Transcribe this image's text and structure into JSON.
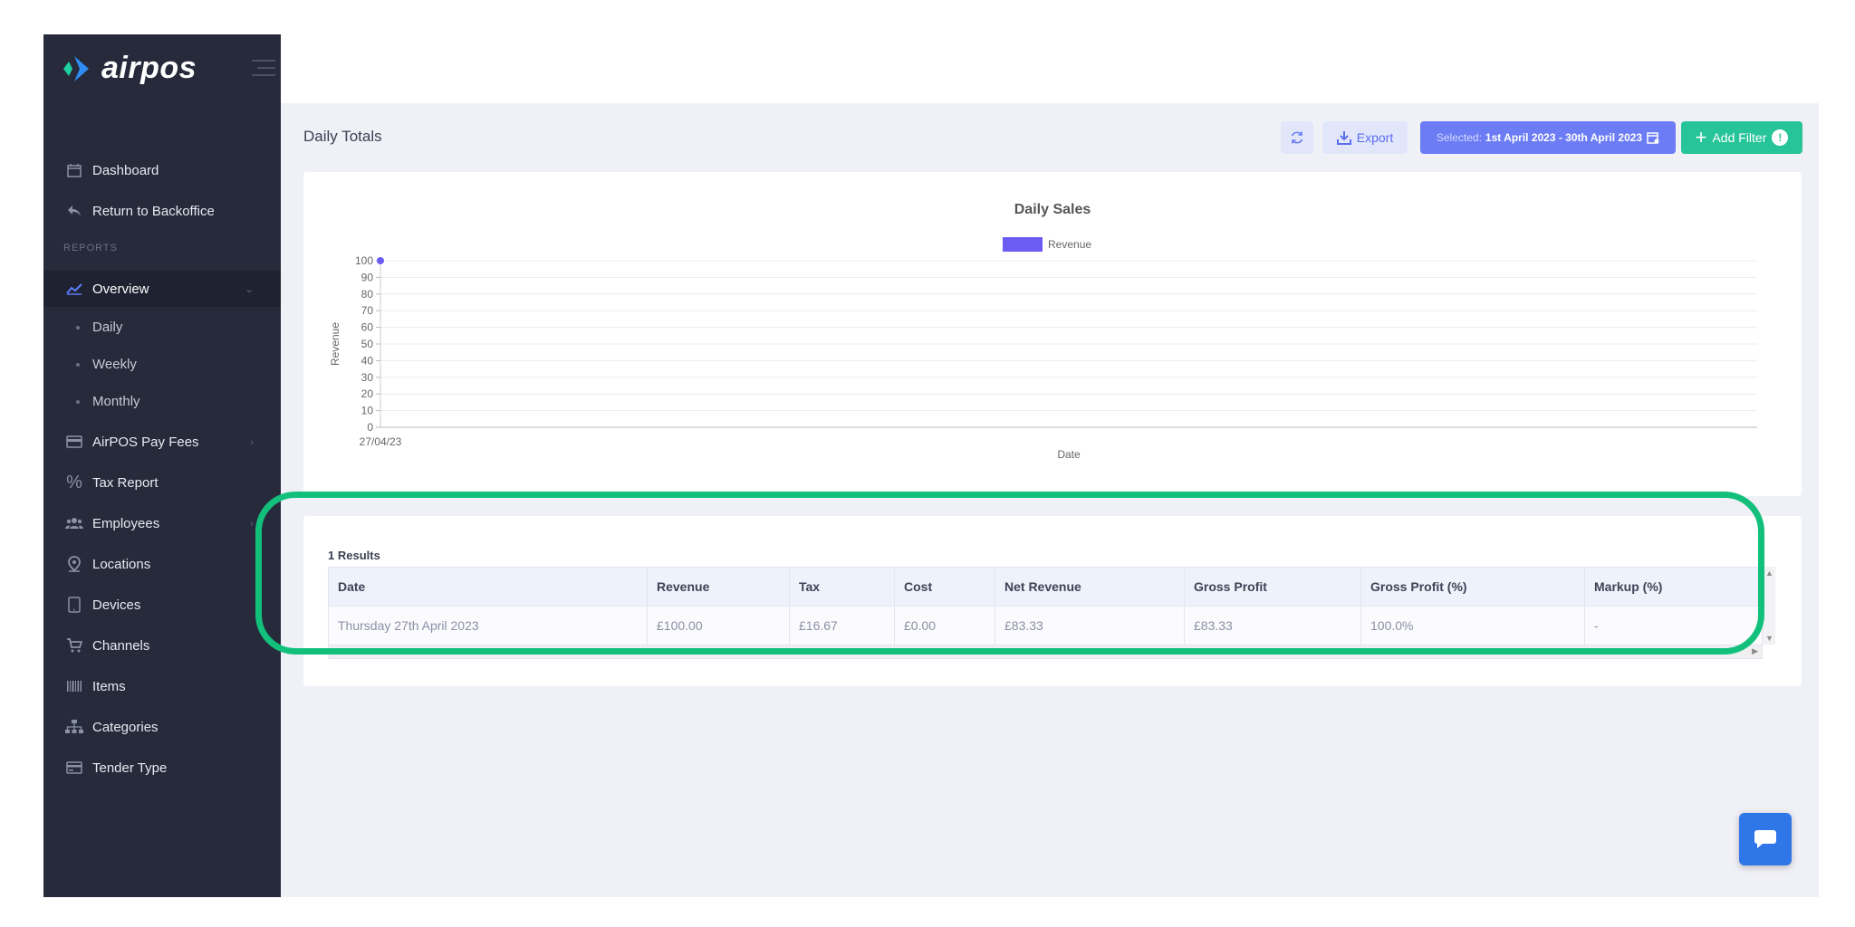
{
  "sidebar": {
    "logo_text": "airpos",
    "items_top": [
      {
        "label": "Dashboard",
        "icon": "calendar-icon"
      },
      {
        "label": "Return to Backoffice",
        "icon": "reply-icon"
      }
    ],
    "section_label": "REPORTS",
    "overview": {
      "label": "Overview",
      "icon": "chart-line-icon"
    },
    "sub_items": [
      "Daily",
      "Weekly",
      "Monthly"
    ],
    "items": [
      {
        "label": "AirPOS Pay Fees",
        "icon": "credit-card-icon"
      },
      {
        "label": "Tax Report",
        "icon": "percent-icon"
      },
      {
        "label": "Employees",
        "icon": "users-icon"
      },
      {
        "label": "Locations",
        "icon": "map-pin-icon"
      },
      {
        "label": "Devices",
        "icon": "tablet-icon"
      },
      {
        "label": "Channels",
        "icon": "cart-icon"
      },
      {
        "label": "Items",
        "icon": "barcode-icon"
      },
      {
        "label": "Categories",
        "icon": "sitemap-icon"
      },
      {
        "label": "Tender Type",
        "icon": "card-icon"
      }
    ]
  },
  "header": {
    "title": "Daily Totals",
    "export_label": "Export",
    "selected_prefix": "Selected:",
    "selected_range": "1st April 2023 - 30th April 2023",
    "add_filter_label": "Add Filter",
    "add_filter_badge": "!"
  },
  "chart_data": {
    "type": "line",
    "title": "Daily Sales",
    "legend": [
      "Revenue"
    ],
    "xlabel": "Date",
    "ylabel": "Revenue",
    "x": [
      "27/04/23"
    ],
    "series": [
      {
        "name": "Revenue",
        "values": [
          100
        ]
      }
    ],
    "ylim": [
      0,
      100
    ],
    "yticks": [
      0,
      10,
      20,
      30,
      40,
      50,
      60,
      70,
      80,
      90,
      100
    ],
    "grid": true,
    "legend_position": "top",
    "color": "#6b5cf4"
  },
  "results": {
    "count_label": "1 Results",
    "columns": [
      "Date",
      "Revenue",
      "Tax",
      "Cost",
      "Net Revenue",
      "Gross Profit",
      "Gross Profit (%)",
      "Markup (%)"
    ],
    "rows": [
      [
        "Thursday 27th April 2023",
        "£100.00",
        "£16.67",
        "£0.00",
        "£83.33",
        "£83.33",
        "100.0%",
        "-"
      ]
    ]
  }
}
